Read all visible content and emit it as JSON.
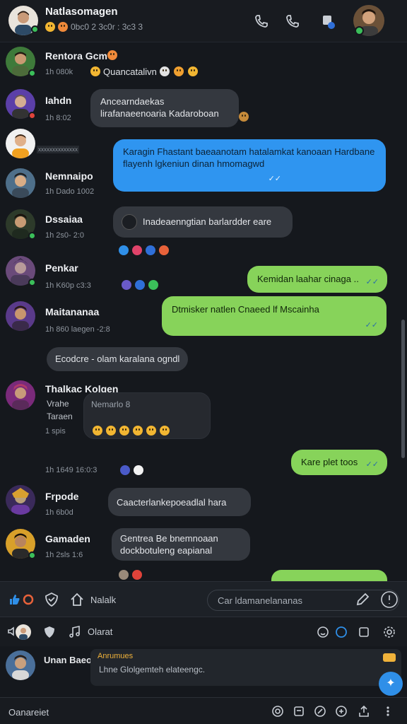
{
  "header": {
    "title": "Natlasomagen",
    "status": "0bc0 2 3c0r : 3c3 3"
  },
  "messages": [
    {
      "sender": "Rentora Gcm",
      "meta": "1h 080k",
      "text": "Quancatalivn"
    },
    {
      "sender": "Iahdn",
      "meta": "1h 8:02",
      "text": "Ancearndaekas lirafanaeenoaria Kadaroboan"
    },
    {
      "sender": "",
      "meta": "",
      "tag": "xxxxxxxxxxxxxx",
      "text": "Karagin Fhastant baeaanotam hatalamkat kanoaan Hardbane flayenh lgkeniun dinan hmomagwd"
    },
    {
      "sender": "Nemnaipo",
      "meta": "1h Dado 1002"
    },
    {
      "sender": "Dssaiaa",
      "meta": "1h 2s0- 2:0",
      "text": "Inadeaenngtian barlardder eare"
    },
    {
      "sender": "Penkar",
      "meta": "1h K60p c3:3",
      "text": "Kemidan laahar cinaga .."
    },
    {
      "sender": "Maitananaa",
      "meta": "1h 860 laegen -2:8",
      "text": "Dtmisker natlen Cnaeed lf Mscainha"
    },
    {
      "sender": "Thalkac Kolgen",
      "meta": "1 spis",
      "side": "Vrahe Taraen",
      "quote": "Nemarlo 8"
    },
    {
      "sender": "",
      "meta": "1h 1649 16:0:3",
      "text": "Kare plet toos"
    },
    {
      "sender": "Frpode",
      "meta": "1h 6b0d",
      "text": "Caacterlankepoeadlal hara"
    },
    {
      "sender": "Gamaden",
      "meta": "1h 2sls 1:6",
      "text": "Gentrea Be bnemnoaan dockbotuleng eapianal"
    }
  ],
  "system_note": "Ecodcre - olam karalana ogndl",
  "composer": {
    "left_label": "Nalalk",
    "placeholder": "Car ldamanelananas"
  },
  "toolbar2": {
    "label": "Olarat"
  },
  "preview": {
    "sender": "Unan Baeo",
    "heading": "Anrumues",
    "text": "Lhne Glolgemteh elateengc."
  },
  "bottom": {
    "label": "Oanareiet"
  },
  "colors": {
    "bg": "#15181d",
    "bubble_dark": "#34383f",
    "bubble_blue": "#2f95f0",
    "bubble_green": "#87d35a",
    "accent": "#2f8fe8"
  }
}
